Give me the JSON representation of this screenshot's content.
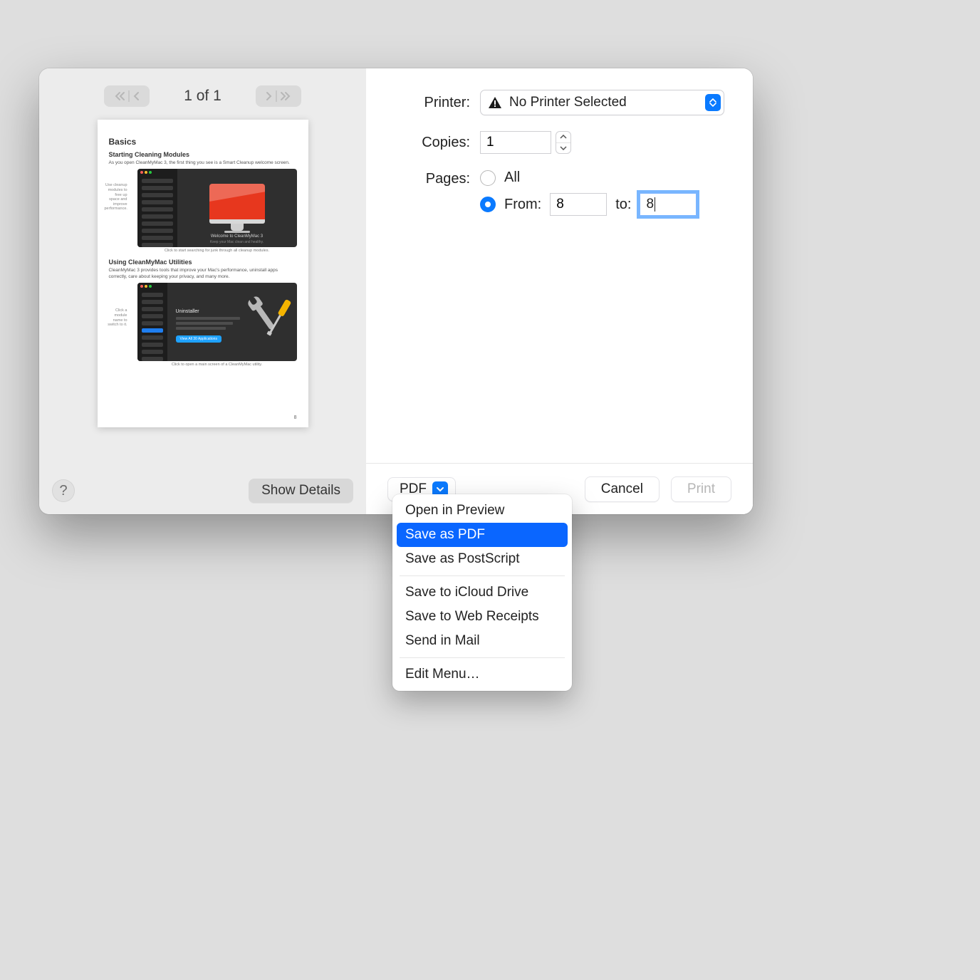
{
  "nav": {
    "page_counter": "1 of 1"
  },
  "preview": {
    "h1": "Basics",
    "sec1_title": "Starting Cleaning Modules",
    "sec1_para": "As you open CleanMyMac 3, the first thing you see is a Smart Cleanup welcome screen.",
    "sec1_tag": "Use cleanup modules to free up space and improve performance.",
    "sec1_welcome": "Welcome to CleanMyMac 3",
    "sec1_sub": "Keep your Mac clean and healthy.",
    "sec1_caption": "Click to start searching for junk through all cleanup modules.",
    "sec2_title": "Using CleanMyMac Utilities",
    "sec2_para": "CleanMyMac 3 provides tools that improve your Mac's performance, uninstall apps correctly, care about keeping your privacy, and many more.",
    "sec2_tag": "Click a module name to switch to it.",
    "sec2_uninstaller": "Uninstaller",
    "sec2_btn": "View All 30 Applications",
    "sec2_caption": "Click to open a main screen of a CleanMyMac utility.",
    "page_number": "8"
  },
  "buttons": {
    "help": "?",
    "show_details": "Show Details",
    "pdf": "PDF",
    "cancel": "Cancel",
    "print": "Print"
  },
  "form": {
    "printer_label": "Printer:",
    "printer_value": "No Printer Selected",
    "copies_label": "Copies:",
    "copies_value": "1",
    "pages_label": "Pages:",
    "pages_all": "All",
    "pages_from": "From:",
    "pages_to": "to:",
    "from_value": "8",
    "to_value": "8",
    "selected_radio": "from"
  },
  "menu": {
    "items": [
      "Open in Preview",
      "Save as PDF",
      "Save as PostScript"
    ],
    "items2": [
      "Save to iCloud Drive",
      "Save to Web Receipts",
      "Send in Mail"
    ],
    "items3": [
      "Edit Menu…"
    ],
    "highlighted": "Save as PDF"
  }
}
